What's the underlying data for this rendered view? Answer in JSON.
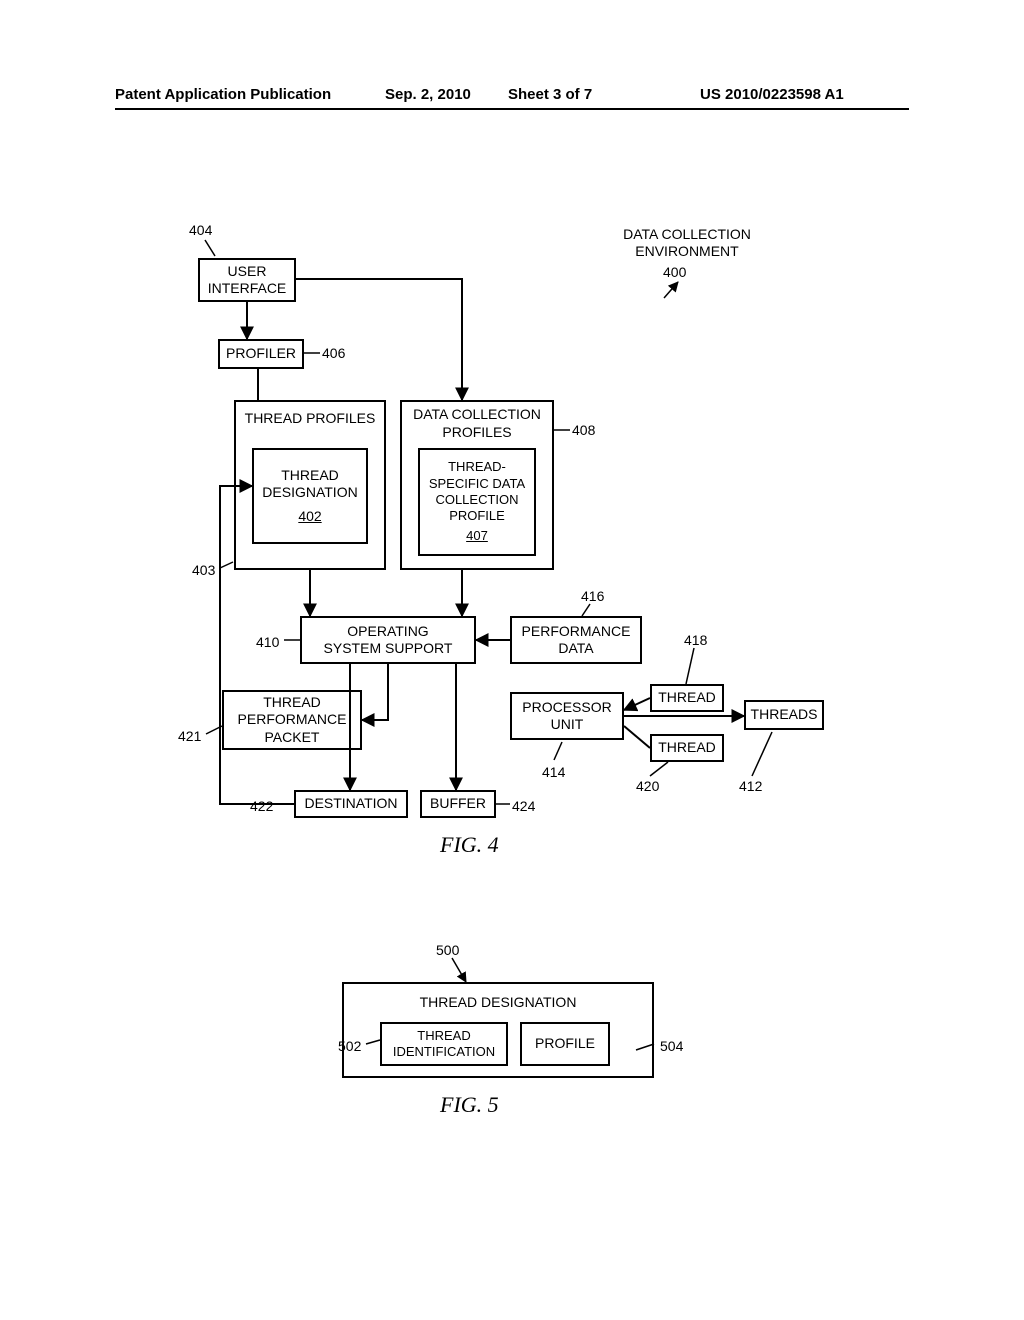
{
  "header": {
    "left": "Patent Application Publication",
    "date": "Sep. 2, 2010",
    "sheet": "Sheet 3 of 7",
    "pubno": "US 2010/0223598 A1"
  },
  "fig4": {
    "title_top": "DATA COLLECTION\nENVIRONMENT",
    "ref_env": "400",
    "user_interface": "USER\nINTERFACE",
    "ref_ui": "404",
    "profiler": "PROFILER",
    "ref_profiler": "406",
    "thread_profiles": "THREAD PROFILES",
    "ref_tp_outer": "403",
    "thread_designation": "THREAD\nDESIGNATION",
    "ref_td": "402",
    "dcp": "DATA COLLECTION\nPROFILES",
    "ref_dcp": "408",
    "tsdcp": "THREAD-\nSPECIFIC DATA\nCOLLECTION\nPROFILE",
    "ref_tsdcp": "407",
    "oss": "OPERATING\nSYSTEM SUPPORT",
    "ref_oss": "410",
    "perf_data": "PERFORMANCE\nDATA",
    "ref_perf": "416",
    "thread_a": "THREAD",
    "ref_thread_a": "418",
    "thread_b": "THREAD",
    "ref_thread_b": "420",
    "threads": "THREADS",
    "ref_threads": "412",
    "proc_unit": "PROCESSOR\nUNIT",
    "ref_proc": "414",
    "tpp": "THREAD\nPERFORMANCE\nPACKET",
    "ref_tpp": "421",
    "destination": "DESTINATION",
    "ref_dest": "422",
    "buffer": "BUFFER",
    "ref_buffer": "424",
    "caption": "FIG. 4"
  },
  "fig5": {
    "ref_outer": "500",
    "title": "THREAD DESIGNATION",
    "tid": "THREAD\nIDENTIFICATION",
    "ref_tid": "502",
    "profile": "PROFILE",
    "ref_profile": "504",
    "caption": "FIG. 5"
  }
}
